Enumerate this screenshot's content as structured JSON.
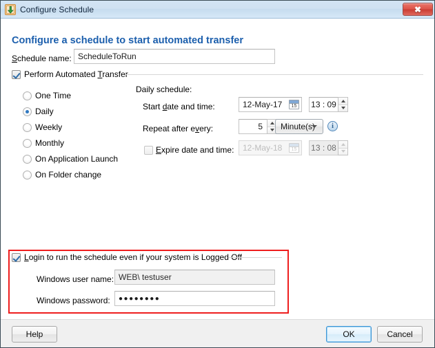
{
  "window": {
    "title": "Configure Schedule",
    "icon": "schedule-transfer-icon",
    "close_label": "✖"
  },
  "heading": "Configure a schedule to start automated transfer",
  "schedule_name": {
    "label": "Schedule name:",
    "value": "ScheduleToRun"
  },
  "perform_transfer": {
    "label": "Perform Automated Transfer",
    "checked": true
  },
  "frequency": {
    "options": [
      {
        "label": "One Time",
        "selected": false
      },
      {
        "label": "Daily",
        "selected": true
      },
      {
        "label": "Weekly",
        "selected": false
      },
      {
        "label": "Monthly",
        "selected": false
      },
      {
        "label": "On Application Launch",
        "selected": false
      },
      {
        "label": "On Folder change",
        "selected": false
      }
    ]
  },
  "daily_schedule": {
    "title": "Daily schedule:",
    "start": {
      "label": "Start date and time:",
      "date": "12-May-17",
      "time": "13 : 09",
      "calendar_day": "15"
    },
    "repeat": {
      "label": "Repeat after every:",
      "value": "5",
      "unit": "Minute(s)",
      "info_icon": "info-icon"
    },
    "expire": {
      "label": "Expire date and time:",
      "checked": false,
      "date": "12-May-18",
      "time": "13 : 08",
      "calendar_day": "15"
    }
  },
  "login_section": {
    "label": "Login to run the schedule even if your system is Logged Off",
    "checked": true,
    "user_name": {
      "label": "Windows user name:",
      "value": "WEB\\ testuser"
    },
    "password": {
      "label": "Windows password:",
      "value": "●●●●●●●●"
    }
  },
  "footer": {
    "help": "Help",
    "ok": "OK",
    "cancel": "Cancel"
  },
  "colors": {
    "heading": "#1c5fad",
    "highlight_box": "#ee1d1d",
    "titlebar": "#cfe1f2",
    "accent": "#2f78c0"
  }
}
